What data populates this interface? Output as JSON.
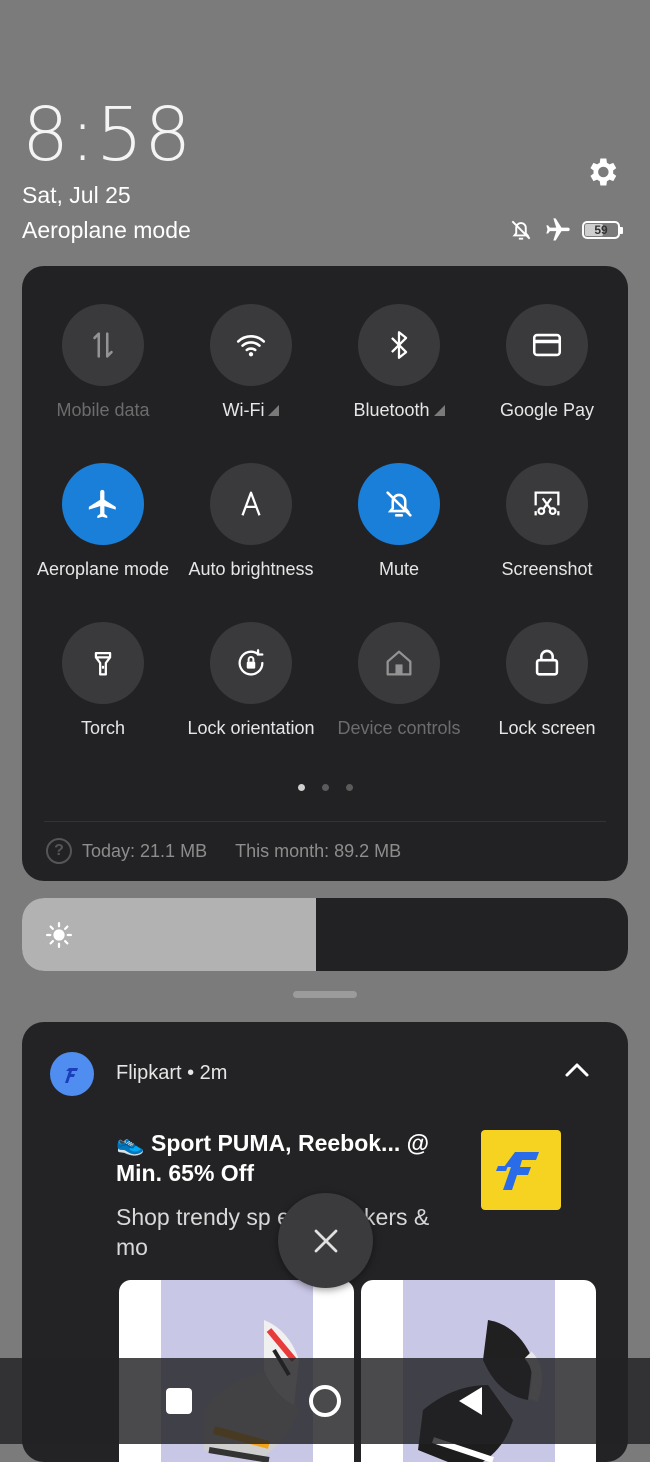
{
  "header": {
    "time": "8:58",
    "date": "Sat, Jul 25",
    "mode": "Aeroplane mode",
    "battery": "59",
    "battery_level": 0.59
  },
  "tiles": [
    {
      "label": "Mobile data",
      "icon": "mobile-data-icon",
      "state": "disabled"
    },
    {
      "label": "Wi-Fi",
      "icon": "wifi-icon",
      "state": "off",
      "signal": true
    },
    {
      "label": "Bluetooth",
      "icon": "bluetooth-icon",
      "state": "off",
      "signal": true
    },
    {
      "label": "Google Pay",
      "icon": "card-icon",
      "state": "off"
    },
    {
      "label": "Aeroplane mode",
      "icon": "airplane-icon",
      "state": "on"
    },
    {
      "label": "Auto brightness",
      "icon": "auto-brightness-icon",
      "state": "off"
    },
    {
      "label": "Mute",
      "icon": "bell-off-icon",
      "state": "on"
    },
    {
      "label": "Screenshot",
      "icon": "screenshot-icon",
      "state": "off"
    },
    {
      "label": "Torch",
      "icon": "torch-icon",
      "state": "off"
    },
    {
      "label": "Lock orientation",
      "icon": "rotation-lock-icon",
      "state": "off"
    },
    {
      "label": "Device controls",
      "icon": "home-icon",
      "state": "disabled"
    },
    {
      "label": "Lock screen",
      "icon": "lock-icon",
      "state": "off"
    }
  ],
  "pager": {
    "pages": 3,
    "active": 0
  },
  "usage": {
    "today": "Today: 21.1 MB",
    "month": "This month: 89.2 MB"
  },
  "brightness": {
    "level": 0.485
  },
  "notification": {
    "app": "Flipkart • 2m",
    "title": "👟 Sport PUMA, Reebok... @ Min. 65% Off",
    "body": "Shop trendy sp        es, sneakers & mo"
  },
  "colors": {
    "accent": "#1a7fd8",
    "panel": "#222224",
    "flipkart_yellow": "#f5d320",
    "flipkart_blue": "#2a6be8"
  }
}
